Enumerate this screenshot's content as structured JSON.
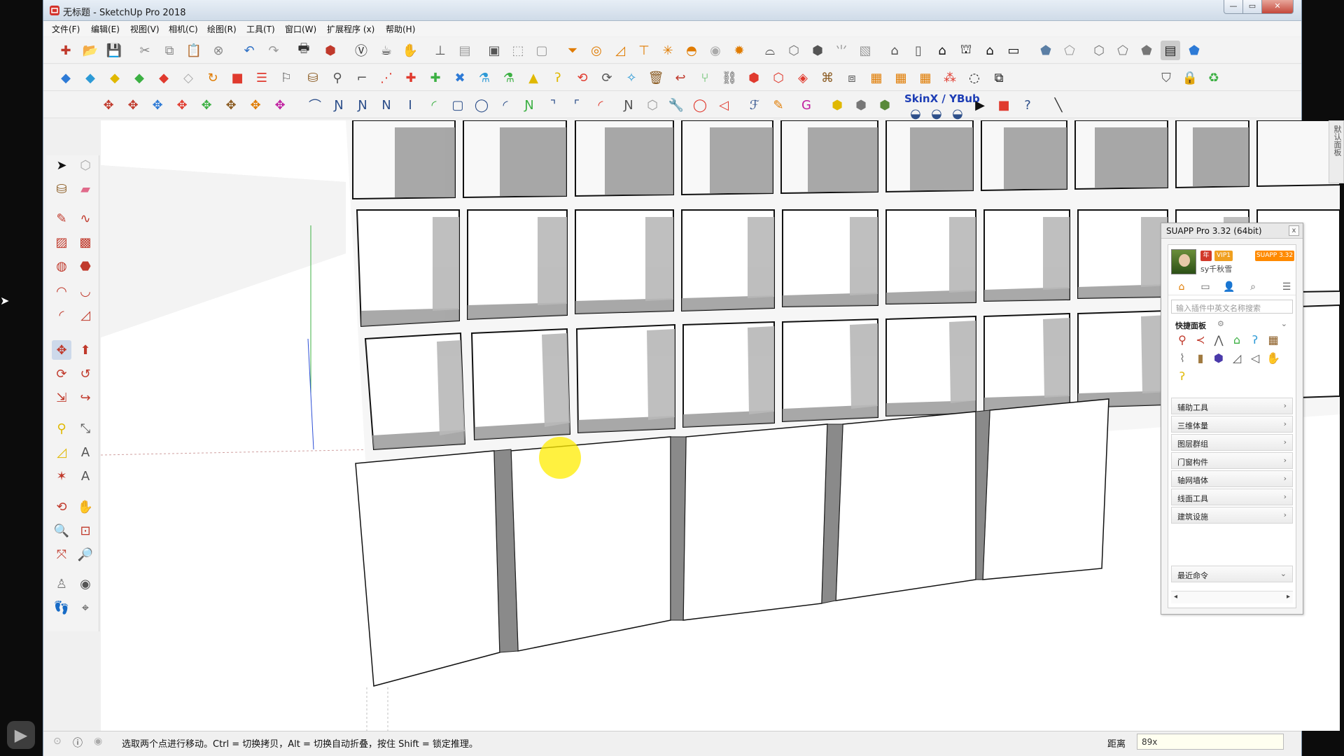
{
  "window": {
    "title": "无标题 - SketchUp Pro 2018",
    "min_label": "—",
    "max_label": "▭",
    "close_label": "✕"
  },
  "menu": [
    "文件(F)",
    "编辑(E)",
    "视图(V)",
    "相机(C)",
    "绘图(R)",
    "工具(T)",
    "窗口(W)",
    "扩展程序 (x)",
    "帮助(H)"
  ],
  "toolbar": {
    "skinx_label": "SkinX / YBub"
  },
  "status": {
    "hint": "选取两个点进行移动。Ctrl = 切换拷贝，Alt = 切换自动折叠，按住 Shift = 锁定推理。",
    "measure_label": "距离",
    "measure_value": "89x"
  },
  "tray": {
    "label": "默认面板"
  },
  "suapp": {
    "title": "SUAPP Pro 3.32 (64bit)",
    "close": "x",
    "badge_year": "年",
    "badge_vip": "VIP1",
    "badge_version": "SUAPP 3.32",
    "username": "sy千秋雪",
    "search_placeholder": "输入插件中英文名称搜索",
    "quick_panel": "快捷面板",
    "categories": [
      {
        "label": "辅助工具",
        "arrow": "›"
      },
      {
        "label": "三维体量",
        "arrow": "›"
      },
      {
        "label": "图层群组",
        "arrow": "›"
      },
      {
        "label": "门窗构件",
        "arrow": "›"
      },
      {
        "label": "轴网墙体",
        "arrow": "›"
      },
      {
        "label": "线面工具",
        "arrow": "›"
      },
      {
        "label": "建筑设施",
        "arrow": "›"
      }
    ],
    "recent": "最近命令",
    "scroll_left": "◂",
    "scroll_right": "▸"
  },
  "colors": {
    "accent": "#1f6fd0",
    "cursor_highlight": "#ffec00",
    "suapp_badge": "#ff8a00"
  }
}
